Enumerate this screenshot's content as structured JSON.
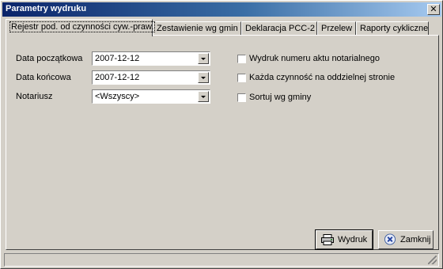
{
  "window": {
    "title": "Parametry wydruku",
    "close_glyph": "✕"
  },
  "tabs": [
    {
      "label": "Rejestr pod. od czynności cyw.-praw.",
      "active": true
    },
    {
      "label": "Zestawienie wg gmin",
      "active": false
    },
    {
      "label": "Deklaracja PCC-2",
      "active": false
    },
    {
      "label": "Przelew",
      "active": false
    },
    {
      "label": "Raporty cykliczne",
      "active": false
    }
  ],
  "form": {
    "date_from": {
      "label": "Data początkowa",
      "value": "2007-12-12"
    },
    "date_to": {
      "label": "Data końcowa",
      "value": "2007-12-12"
    },
    "notary": {
      "label": "Notariusz",
      "value": "<Wszyscy>"
    }
  },
  "options": [
    {
      "label": "Wydruk numeru aktu notarialnego",
      "checked": false
    },
    {
      "label": "Każda czynność na oddzielnej stronie",
      "checked": false
    },
    {
      "label": "Sortuj wg gminy",
      "checked": false
    }
  ],
  "buttons": {
    "print": {
      "label": "Wydruk",
      "icon": "printer-icon"
    },
    "close": {
      "label": "Zamknij",
      "icon": "close-circle-icon"
    }
  },
  "colors": {
    "title_gradient_start": "#0a246a",
    "title_gradient_end": "#a6caf0",
    "face": "#d4d0c8"
  }
}
